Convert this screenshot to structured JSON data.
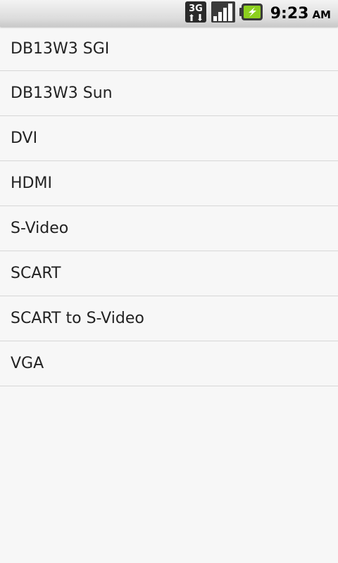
{
  "status_bar": {
    "icons": [
      "3g-data-icon",
      "signal-strength-icon",
      "battery-charging-icon"
    ],
    "network_label": "3G",
    "time": "9:23",
    "ampm": "AM"
  },
  "list": {
    "items": [
      {
        "label": "DB13W3 SGI"
      },
      {
        "label": "DB13W3 Sun"
      },
      {
        "label": "DVI"
      },
      {
        "label": "HDMI"
      },
      {
        "label": "S-Video"
      },
      {
        "label": "SCART"
      },
      {
        "label": "SCART to S-Video"
      },
      {
        "label": "VGA"
      }
    ]
  }
}
